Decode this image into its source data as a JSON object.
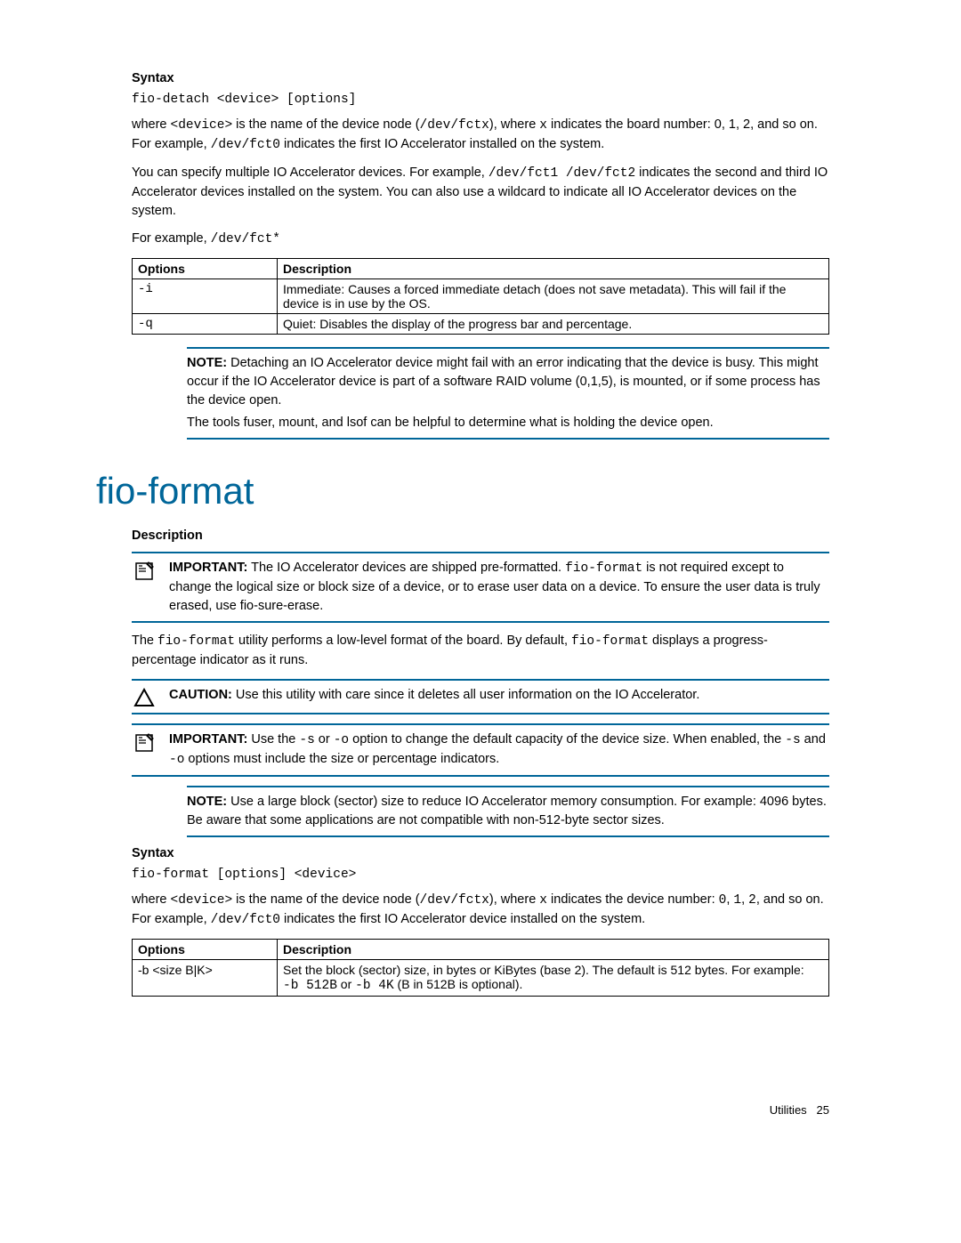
{
  "syntax1_head": "Syntax",
  "syntax1_code": "fio-detach <device> [options]",
  "p1a": "where ",
  "p1b": "<device>",
  "p1c": " is the name of the device node (",
  "p1d": "/dev/fctx",
  "p1e": "), where ",
  "p1f": "x",
  "p1g": " indicates the board number: 0, 1, 2, and so on. For example, ",
  "p1h": "/dev/fct0",
  "p1i": " indicates the first IO Accelerator installed on the system.",
  "p2a": "You can specify multiple IO Accelerator devices. For example, ",
  "p2b": "/dev/fct1 /dev/fct2",
  "p2c": " indicates the second and third IO Accelerator devices installed on the system. You can also use a wildcard to indicate all IO Accelerator devices on the system.",
  "p3a": "For example, ",
  "p3b": "/dev/fct*",
  "table1": {
    "h1": "Options",
    "h2": "Description",
    "r1c1": "-i",
    "r1c2": "Immediate: Causes a forced immediate detach (does not save metadata). This will fail if the device is in use by the OS.",
    "r2c1": "-q",
    "r2c2": "Quiet: Disables the display of the progress bar and percentage."
  },
  "note1_label": "NOTE:",
  "note1_text": "  Detaching an IO Accelerator device might fail with an error indicating that the device is busy. This might occur if the IO Accelerator device is part of a software RAID volume (0,1,5), is mounted, or if some process has the device open.",
  "note1_text2": "The tools fuser, mount, and lsof can be helpful to determine what is holding the device open.",
  "section_title": "fio-format",
  "desc_head": "Description",
  "imp1_label": "IMPORTANT:",
  "imp1_a": "  The IO Accelerator devices are shipped pre-formatted. ",
  "imp1_b": "fio-format",
  "imp1_c": " is not required except to change the logical size or block size of a device, or to erase user data on a device. To ensure the user data is truly erased, use fio-sure-erase.",
  "p4a": "The ",
  "p4b": "fio-format",
  "p4c": " utility performs a low-level format of the board. By default, ",
  "p4d": "fio-format",
  "p4e": " displays a progress-percentage indicator as it runs.",
  "caution_label": "CAUTION:",
  "caution_text": "  Use this utility with care since it deletes all user information on the IO Accelerator.",
  "imp2_label": "IMPORTANT:",
  "imp2_a": "  Use the ",
  "imp2_b": "-s",
  "imp2_c": " or ",
  "imp2_d": "-o",
  "imp2_e": " option to change the default capacity of the device size. When enabled, the ",
  "imp2_f": "-s",
  "imp2_g": " and ",
  "imp2_h": "-o",
  "imp2_i": " options must include the size or percentage indicators.",
  "note2_label": "NOTE:",
  "note2_text": "  Use a large block (sector) size to reduce IO Accelerator memory consumption. For example: 4096 bytes. Be aware that some applications are not compatible with non-512-byte sector sizes.",
  "syntax2_head": "Syntax",
  "syntax2_code": "fio-format [options] <device>",
  "p5a": "where ",
  "p5b": "<device>",
  "p5c": " is the name of the device node (",
  "p5d": "/dev/fctx",
  "p5e": "), where ",
  "p5f": "x",
  "p5g": " indicates the device number: ",
  "p5h": "0",
  "p5i": ", ",
  "p5j": "1",
  "p5k": ", ",
  "p5l": "2",
  "p5m": ", and so on. For example, ",
  "p5n": "/dev/fct0",
  "p5o": " indicates the first IO Accelerator device installed on the system.",
  "table2": {
    "h1": "Options",
    "h2": "Description",
    "r1c1": "-b <size B|K>",
    "r1c2a": "Set the block (sector) size, in bytes or KiBytes (base 2). The default is 512 bytes. For example: ",
    "r1c2b": "-b 512B",
    "r1c2c": " or ",
    "r1c2d": "-b 4K",
    "r1c2e": " (B in 512B is optional)."
  },
  "footer_label": "Utilities",
  "footer_page": "25"
}
